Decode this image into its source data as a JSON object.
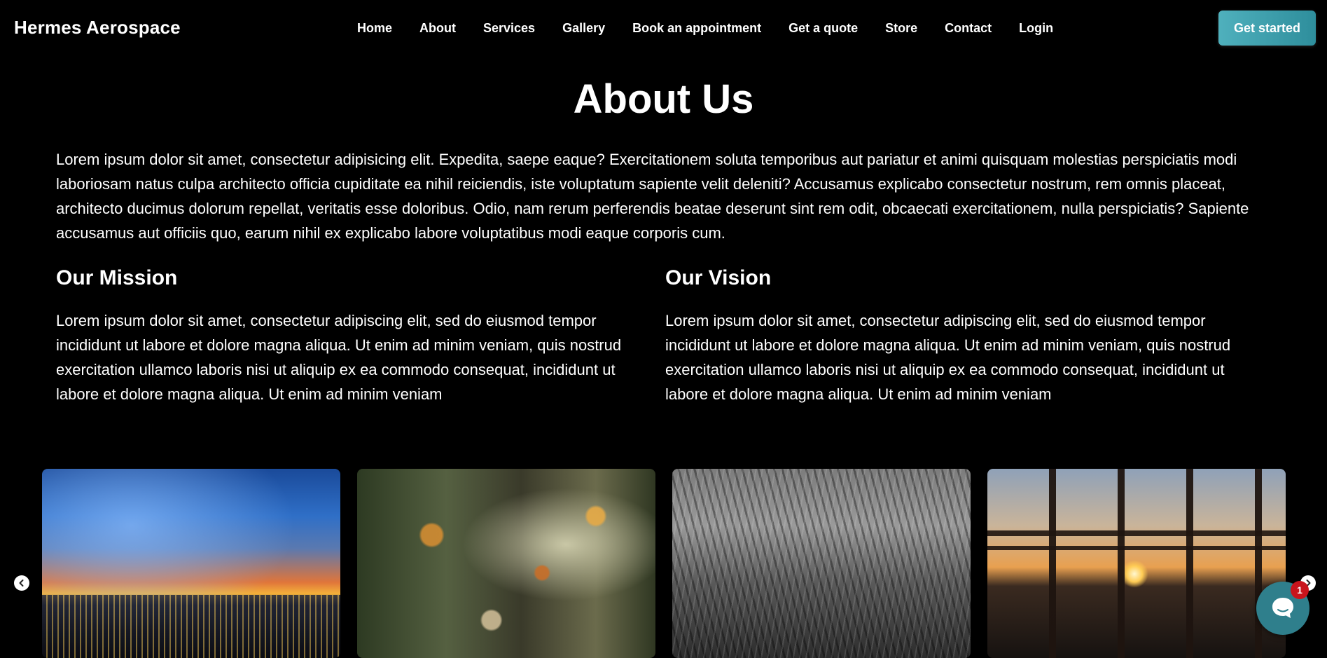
{
  "header": {
    "brand": "Hermes Aerospace",
    "nav": [
      "Home",
      "About",
      "Services",
      "Gallery",
      "Book an appointment",
      "Get a quote",
      "Store",
      "Contact",
      "Login"
    ],
    "cta_label": "Get started"
  },
  "about": {
    "title": "About Us",
    "intro": "Lorem ipsum dolor sit amet, consectetur adipisicing elit. Expedita, saepe eaque? Exercitationem soluta temporibus aut pariatur et animi quisquam molestias perspiciatis modi laboriosam natus culpa architecto officia cupiditate ea nihil reiciendis, iste voluptatum sapiente velit deleniti? Accusamus explicabo consectetur nostrum, rem omnis placeat, architecto ducimus dolorum repellat, veritatis esse doloribus. Odio, nam rerum perferendis beatae deserunt sint rem odit, obcaecati exercitationem, nulla perspiciatis? Sapiente accusamus aut officiis quo, earum nihil ex explicabo labore voluptatibus modi eaque corporis cum.",
    "mission": {
      "heading": "Our Mission",
      "text": "Lorem ipsum dolor sit amet, consectetur adipiscing elit, sed do eiusmod tempor incididunt ut labore et dolore magna aliqua. Ut enim ad minim veniam, quis nostrud exercitation ullamco laboris nisi ut aliquip ex ea commodo consequat, incididunt ut labore et dolore magna aliqua. Ut enim ad minim veniam"
    },
    "vision": {
      "heading": "Our Vision",
      "text": "Lorem ipsum dolor sit amet, consectetur adipiscing elit, sed do eiusmod tempor incididunt ut labore et dolore magna aliqua. Ut enim ad minim veniam, quis nostrud exercitation ullamco laboris nisi ut aliquip ex ea commodo consequat, incididunt ut labore et dolore magna aliqua. Ut enim ad minim veniam"
    }
  },
  "gallery": {
    "images": [
      "city-skyline-sunset",
      "autumn-leaves-falling",
      "grass-black-and-white",
      "highway-sunset-through-fence"
    ],
    "prev_icon": "chevron-left-icon",
    "next_icon": "chevron-right-icon"
  },
  "chat": {
    "icon": "chat-bubble-icon",
    "badge_count": "1",
    "color": "#2f7f8c",
    "badge_color": "#c8141c"
  },
  "colors": {
    "background": "#000000",
    "cta": "#3fa3b0"
  }
}
